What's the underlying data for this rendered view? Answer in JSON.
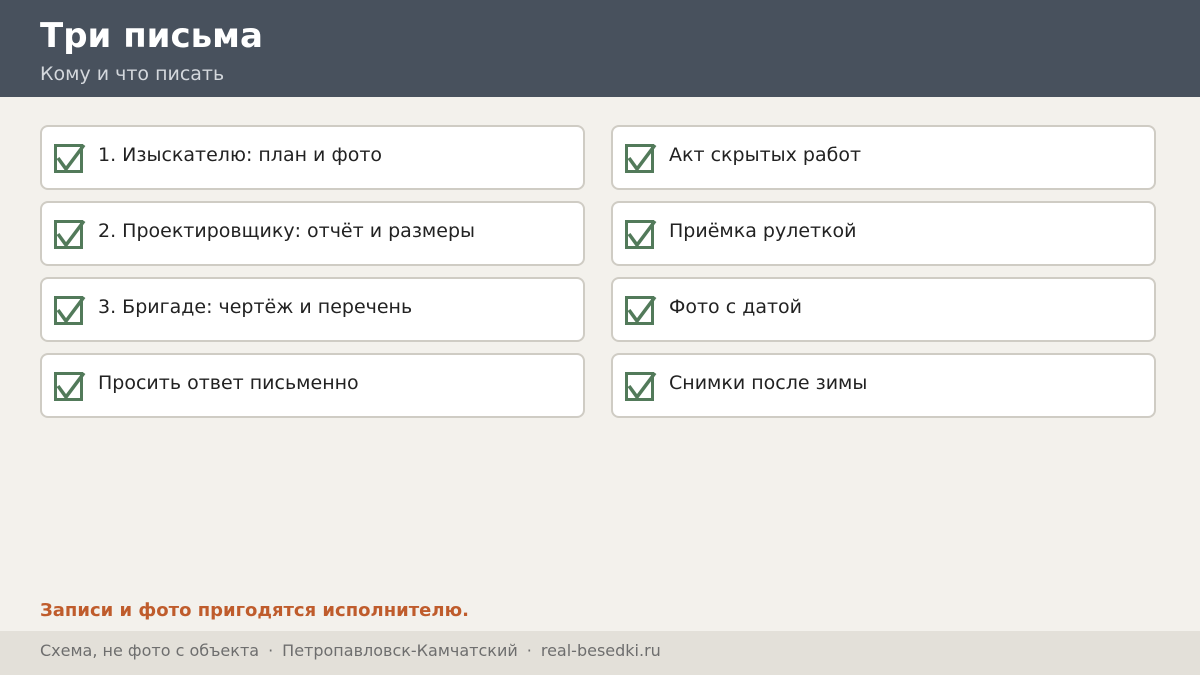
{
  "header": {
    "title": "Три письма",
    "subtitle": "Кому и что писать"
  },
  "checklist": {
    "left": [
      {
        "label": "1. Изыскателю: план и фото",
        "checked": true
      },
      {
        "label": "2. Проектировщику: отчёт и размеры",
        "checked": true
      },
      {
        "label": "3. Бригаде: чертёж и перечень",
        "checked": true
      },
      {
        "label": "Просить ответ письменно",
        "checked": true
      }
    ],
    "right": [
      {
        "label": "Акт скрытых работ",
        "checked": true
      },
      {
        "label": "Приёмка рулеткой",
        "checked": true
      },
      {
        "label": "Фото с датой",
        "checked": true
      },
      {
        "label": "Снимки после зимы",
        "checked": true
      }
    ]
  },
  "note": "Записи и фото пригодятся исполнителю.",
  "footer": {
    "items": [
      "Схема, не фото с объекта",
      "Петропавловск-Камчатский",
      "real-besedki.ru"
    ],
    "separator": "·"
  },
  "colors": {
    "header_bg": "#48515d",
    "check": "#527a5a",
    "note": "#bf5c2c",
    "page_bg": "#f3f1ec",
    "footer_bg": "#e3e0d9"
  },
  "icons": {
    "checkbox": "checkmark-icon"
  }
}
